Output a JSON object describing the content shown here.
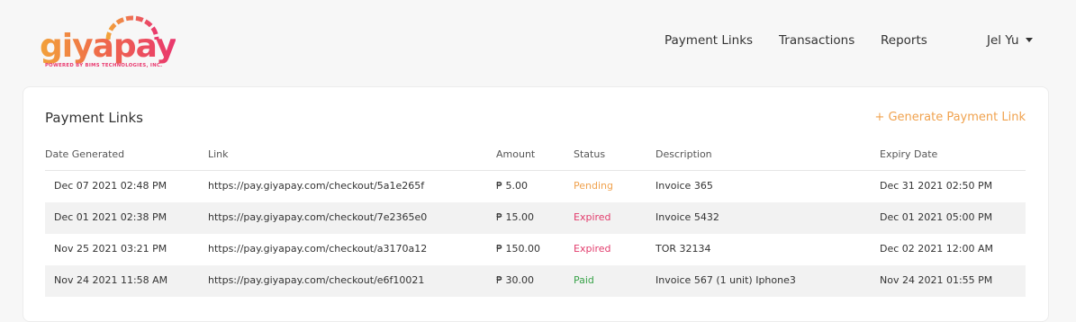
{
  "brand": {
    "name": "giyapay",
    "tagline": "POWERED BY BIMS TECHNOLOGIES, INC.",
    "gradient_start": "#f2a23a",
    "gradient_end": "#e9386e"
  },
  "nav": {
    "items": [
      {
        "label": "Payment Links"
      },
      {
        "label": "Transactions"
      },
      {
        "label": "Reports"
      }
    ],
    "user_name": "Jel Yu"
  },
  "card": {
    "title": "Payment Links",
    "generate_label": "+ Generate Payment Link"
  },
  "table": {
    "headers": [
      "Date Generated",
      "Link",
      "Amount",
      "Status",
      "Description",
      "Expiry Date"
    ],
    "rows": [
      {
        "date": "Dec 07 2021 02:48 PM",
        "link": "https://pay.giyapay.com/checkout/5a1e265f",
        "amount": "₱ 5.00",
        "status": "Pending",
        "status_color": "#f0a24e",
        "description": "Invoice 365",
        "expiry": "Dec 31 2021 02:50 PM"
      },
      {
        "date": "Dec 01 2021 02:38 PM",
        "link": "https://pay.giyapay.com/checkout/7e2365e0",
        "amount": "₱ 15.00",
        "status": "Expired",
        "status_color": "#e23c6c",
        "description": "Invoice 5432",
        "expiry": "Dec 01 2021 05:00 PM"
      },
      {
        "date": "Nov 25 2021 03:21 PM",
        "link": "https://pay.giyapay.com/checkout/a3170a12",
        "amount": "₱ 150.00",
        "status": "Expired",
        "status_color": "#e23c6c",
        "description": "TOR 32134",
        "expiry": "Dec 02 2021 12:00 AM"
      },
      {
        "date": "Nov 24 2021 11:58 AM",
        "link": "https://pay.giyapay.com/checkout/e6f10021",
        "amount": "₱ 30.00",
        "status": "Paid",
        "status_color": "#3aa34a",
        "description": "Invoice 567 (1 unit) Iphone3",
        "expiry": "Nov 24 2021 01:55 PM"
      }
    ]
  }
}
